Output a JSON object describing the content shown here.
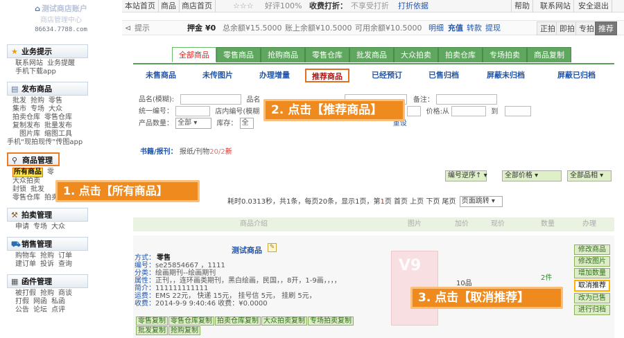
{
  "header": {
    "shop_name": "测试商店账户",
    "shop_sub": "商店管理中心",
    "account_id": "86634.7788.com",
    "top_links": [
      "本站首页",
      "商品",
      "商店首页"
    ],
    "stars": "☆☆☆",
    "rating_text": "好评100%",
    "fee_label": "收费打折：",
    "fee_status": "不享受打折",
    "fee_basis": "打折依据",
    "right_links": [
      "帮助",
      "联系网站",
      "安全退出"
    ]
  },
  "infobar": {
    "tip_label": "提示",
    "deposit_label": "押金",
    "deposit_value": "¥0",
    "total_balance": "总余额¥15.5000",
    "account_balance": "账上余额¥10.5000",
    "available_balance": "可用余额¥10.5000",
    "links": [
      "明细",
      "充值",
      "转款",
      "提现"
    ],
    "right_buttons": [
      "正拍",
      "即拍",
      "专拍",
      "推荐"
    ]
  },
  "sidebar": {
    "sections": [
      {
        "icon": "star-icon",
        "title": "业务提示",
        "items": [
          "联系网站",
          "业务提醒",
          "手机下载app"
        ]
      },
      {
        "icon": "note-icon",
        "title": "发布商品",
        "items": [
          "批发",
          "抢购",
          "零售",
          "集市",
          "专场",
          "大众",
          "拍卖仓库",
          "零售仓库",
          "复制发布",
          "批量发布",
          "图片库",
          "缩图工具",
          "手机“现拍现传”传图app"
        ]
      },
      {
        "icon": "magnifier-icon",
        "title": "商品管理",
        "items": [
          "所有商品",
          "零",
          "大众拍卖",
          "封锁",
          "批发",
          "零售仓库",
          "拍卖仓库"
        ]
      },
      {
        "icon": "gavel-icon",
        "title": "拍卖管理",
        "items": [
          "申请",
          "专场",
          "大众"
        ]
      },
      {
        "icon": "cart-icon",
        "title": "销售管理",
        "items": [
          "购物车",
          "抢购",
          "订单",
          "建订单",
          "投诉",
          "查询"
        ]
      },
      {
        "icon": "grid-icon",
        "title": "函件管理",
        "items": [
          "被打假",
          "抢购",
          "商谈",
          "打假",
          "网函",
          "私函",
          "公告",
          "论坛",
          "点评"
        ]
      }
    ]
  },
  "main_tabs": [
    "全部商品",
    "零售商品",
    "抢购商品",
    "零售仓库",
    "批发商品",
    "大众拍卖",
    "拍卖仓库",
    "专场拍卖",
    "商品复制"
  ],
  "sub_tabs": [
    "未售商品",
    "未传图片",
    "办理增量",
    "推荐商品",
    "已经预订",
    "已售归档",
    "屏蔽未归档",
    "屏蔽已归档"
  ],
  "filter": {
    "name_fuzzy": "品名(模糊):",
    "name2": "品名",
    "remark": "备注：",
    "uniform_no": "统一编号：",
    "store_no": "店内编号(模糊",
    "price_from": "价格:从",
    "price_to": "到",
    "qty_label": "产品数量：",
    "qty_value": "全部",
    "stock_label": "库存：",
    "stock_value": "全",
    "reset": "重设"
  },
  "book_line": {
    "label": "书籍/报刊：",
    "value_a": "报纸/刊物",
    "value_b": "20/2",
    "value_c": "新"
  },
  "controls": {
    "sort": "编号逆序↑",
    "price": "全部价格",
    "category": "全部品相"
  },
  "pager": {
    "text": "耗时0.0313秒，共1条，每页20条，显示1页，第",
    "page": "1",
    "tail": "页 首页 上页 下页  尾页",
    "jump": "页面跳转"
  },
  "table_head": [
    "商品介绍",
    "图片",
    "加价",
    "现价",
    "数量",
    "办理"
  ],
  "item": {
    "title": "测试商品",
    "lines": [
      [
        "方式：",
        "零售"
      ],
      [
        "编号：",
        "se25854667 ，1111"
      ],
      [
        "分类：",
        "绘画期刊--绘画期刊"
      ],
      [
        "属性：",
        "正刊，，连环画类期刊，黑白绘画，民国，，8开，1-9画，，，，"
      ],
      [
        "简介：",
        "111111111111"
      ],
      [
        "运费：",
        "EMS 22元， 快递 15元， 挂号信 5元， 挂刷 5元，"
      ],
      [
        "收费：",
        "2014-9-9 9:40:46    收费：¥0.0000"
      ]
    ],
    "copy_buttons": [
      "零售复制",
      "零售仓库复制",
      "拍卖仓库复制",
      "大众拍卖复制",
      "专场拍卖复制",
      "批发复制",
      "抢购复制"
    ],
    "thumb_text": "V9",
    "price": "10品",
    "qty": "2件",
    "ops": [
      "修改商品",
      "修改图片",
      "增加数量",
      "取消推荐",
      "改为已售",
      "进行归档"
    ]
  },
  "callouts": {
    "step1": "1. 点击【所有商品】",
    "step2": "2. 点击【推荐商品】",
    "step3": "3. 点击【取消推荐】"
  },
  "colors": {
    "accent_orange": "#ef8a1e",
    "tab_green": "#5fa65f",
    "link_blue": "#2255aa",
    "highlight_yellow": "#ffe24a"
  }
}
